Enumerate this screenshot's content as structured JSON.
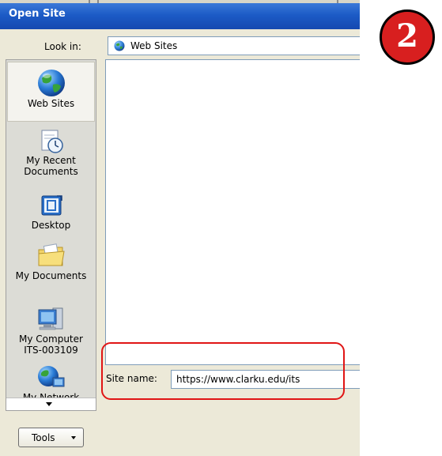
{
  "window": {
    "title": "Open Site"
  },
  "lookin": {
    "label": "Look in:",
    "value": "Web Sites",
    "icon": "globe-icon"
  },
  "places": [
    {
      "label": "Web Sites",
      "icon": "globe-icon",
      "selected": true
    },
    {
      "label": "My Recent Documents",
      "icon": "recent-documents-icon"
    },
    {
      "label": "Desktop",
      "icon": "desktop-icon"
    },
    {
      "label": "My Documents",
      "icon": "folder-icon"
    },
    {
      "label": "My Computer ITS-003109",
      "icon": "computer-icon"
    },
    {
      "label": "My Network",
      "icon": "network-icon"
    }
  ],
  "sitename": {
    "label": "Site name:",
    "value": "https://www.clarku.edu/its"
  },
  "tools": {
    "label": "Tools"
  },
  "badge": {
    "text": "2"
  },
  "colors": {
    "titlebar": "#1c5bc6",
    "dialog_bg": "#ece9d8",
    "highlight": "#e01515",
    "badge": "#d81f1f"
  }
}
